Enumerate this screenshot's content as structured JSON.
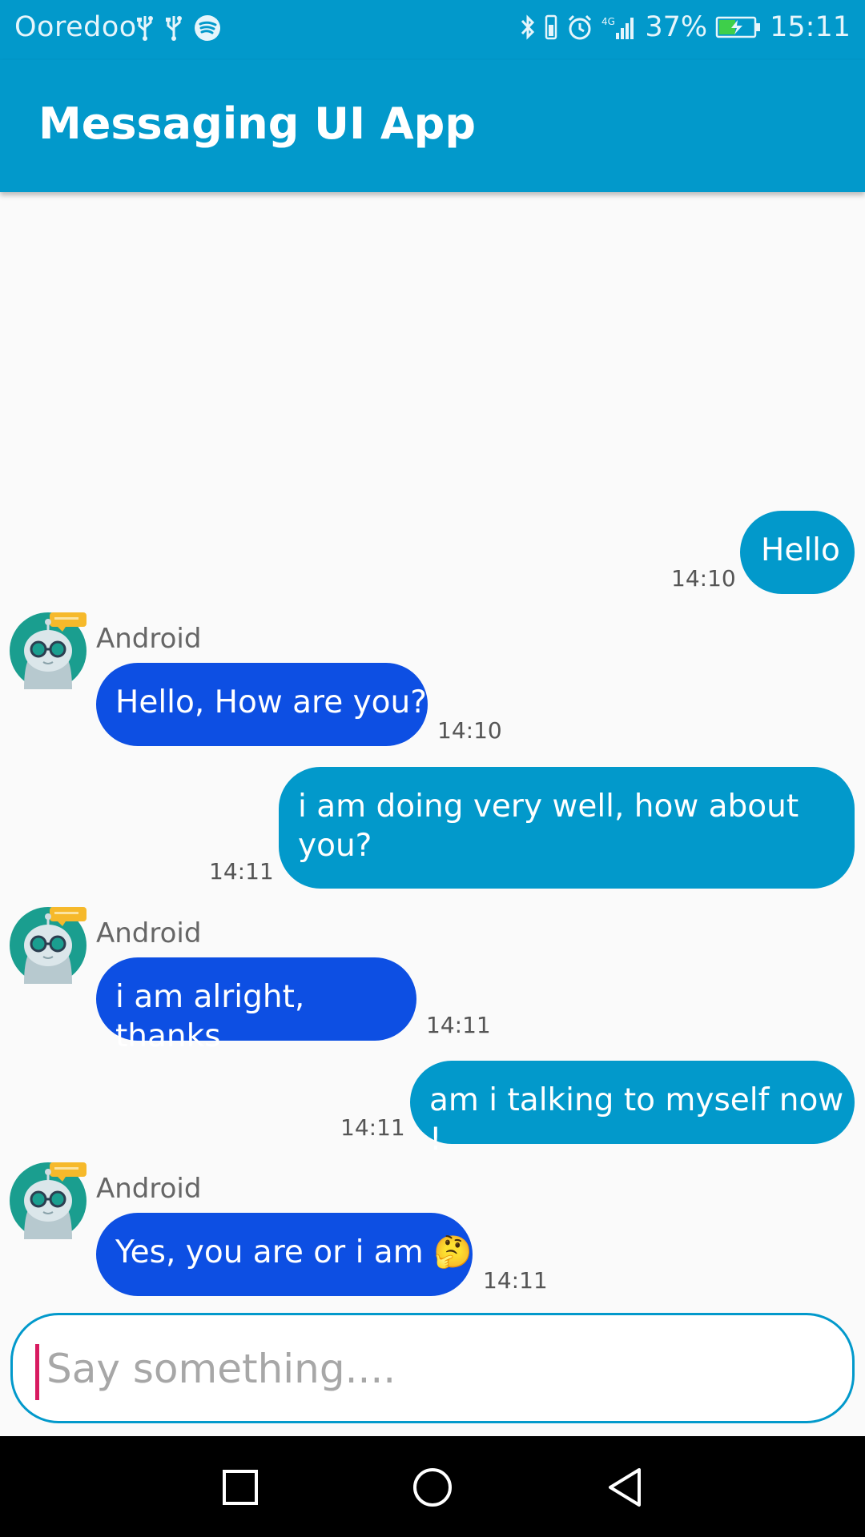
{
  "status_bar": {
    "carrier": "Ooredoo",
    "network": "4G",
    "battery_percent": "37%",
    "time": "15:11",
    "icons": [
      "usb-icon",
      "usb-icon",
      "spotify-icon",
      "bluetooth-icon",
      "vibrate-icon",
      "alarm-icon",
      "signal-icon",
      "battery-charging-icon"
    ]
  },
  "toolbar": {
    "title": "Messaging UI App"
  },
  "messages": [
    {
      "direction": "outgoing",
      "text": "Hello",
      "time": "14:10"
    },
    {
      "direction": "incoming",
      "sender": "Android",
      "text": "Hello, How are you?",
      "time": "14:10"
    },
    {
      "direction": "outgoing",
      "text": "i am doing very well, how about you?",
      "time": "14:11"
    },
    {
      "direction": "incoming",
      "sender": "Android",
      "text": "i am alright, thanks",
      "time": "14:11"
    },
    {
      "direction": "outgoing",
      "text": "am i talking to myself now !",
      "time": "14:11"
    },
    {
      "direction": "incoming",
      "sender": "Android",
      "text": "Yes, you are or i am 🤔",
      "time": "14:11"
    }
  ],
  "composer": {
    "placeholder": "Say something...."
  },
  "colors": {
    "primary": "#0299cb",
    "incoming_bubble": "#0d4fe3",
    "outgoing_bubble": "#0299cb",
    "caret": "#d81b60"
  },
  "nav_bar": {
    "icons": [
      "recents-icon",
      "home-icon",
      "back-icon"
    ]
  }
}
